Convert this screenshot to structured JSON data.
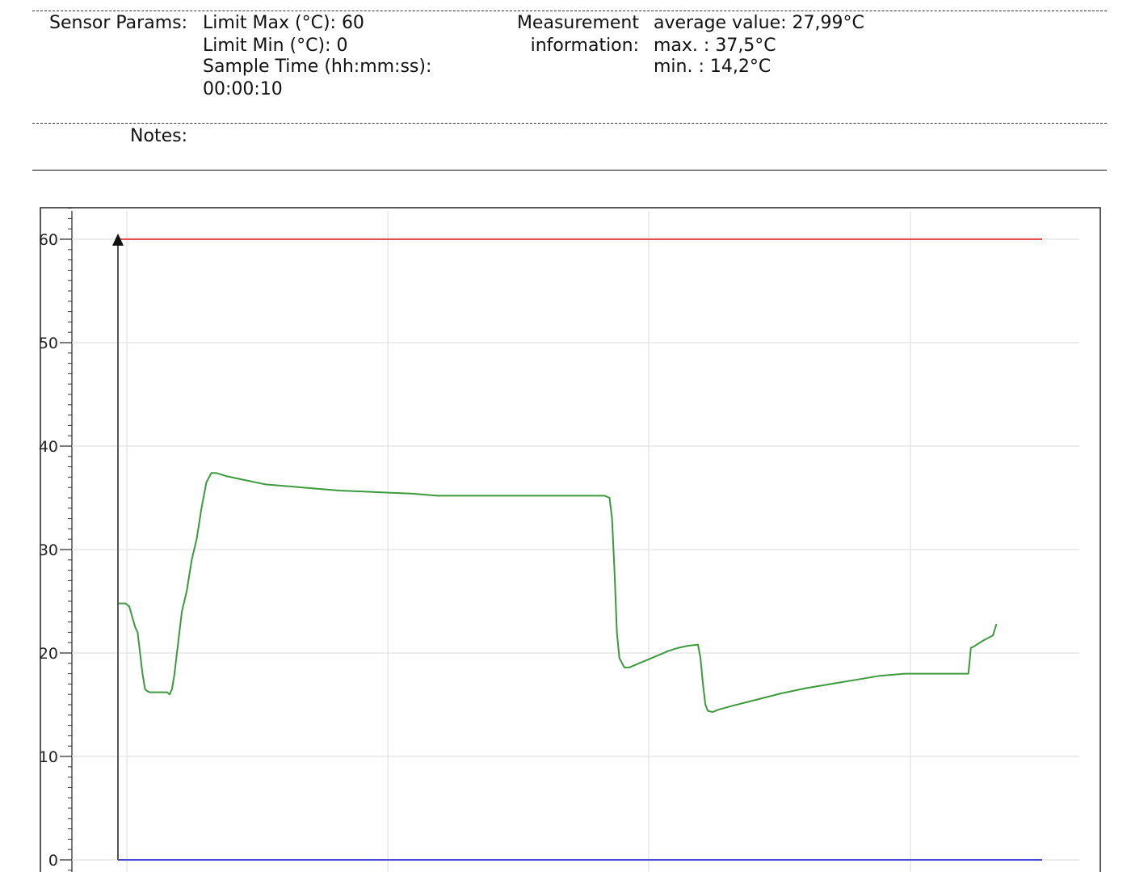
{
  "report": {
    "sensor_label": "Sensor Params:",
    "limit_max": "Limit Max (°C): 60",
    "limit_min": "Limit Min (°C): 0",
    "sample_time_label": "Sample Time (hh:mm:ss):",
    "sample_time_value": "00:00:10",
    "measurement_label_1": "Measurement",
    "measurement_label_2": "information:",
    "avg_value": "average value: 27,99°C",
    "max_value": "max. : 37,5°C",
    "min_value": "min. : 14,2°C",
    "notes_label": "Notes:"
  },
  "chart_data": {
    "type": "line",
    "y_ticks": [
      "0",
      "10",
      "20",
      "30",
      "40",
      "50",
      "60"
    ],
    "ylim": [
      -1.2,
      63
    ],
    "xlim": [
      0,
      188
    ],
    "grid": true,
    "colors": {
      "temperature": "#3c9a3c",
      "max_limit": "#e8504f",
      "min_limit": "#4a4ad8",
      "axis": "#555555",
      "grid": "#dddddd"
    },
    "max_limit": 60,
    "min_limit": 0,
    "x": [
      0,
      1.5,
      2.3,
      3.5,
      4,
      5,
      5.5,
      6,
      6.5,
      8,
      10,
      10.5,
      11,
      11.5,
      12,
      13,
      14,
      15,
      16,
      17,
      18,
      19,
      20,
      22,
      25,
      28,
      30,
      35,
      40,
      45,
      50,
      55,
      60,
      65,
      70,
      75,
      80,
      85,
      90,
      95,
      99,
      100,
      100.5,
      101,
      101.5,
      102,
      103,
      104,
      106,
      108,
      110,
      112,
      114,
      116,
      118,
      118.5,
      119,
      119.5,
      120,
      121,
      122,
      125,
      130,
      135,
      140,
      145,
      150,
      155,
      160,
      165,
      170,
      173,
      173.5,
      174,
      176,
      178,
      178.7
    ],
    "y": [
      24.8,
      24.8,
      24.5,
      22.5,
      22,
      18,
      16.5,
      16.3,
      16.2,
      16.2,
      16.2,
      16,
      16.5,
      18,
      20,
      24,
      26,
      29,
      31,
      34,
      36.5,
      37.4,
      37.4,
      37.1,
      36.8,
      36.5,
      36.3,
      36.1,
      35.9,
      35.7,
      35.6,
      35.5,
      35.4,
      35.2,
      35.2,
      35.2,
      35.2,
      35.2,
      35.2,
      35.2,
      35.2,
      35.0,
      33,
      28,
      22,
      19.5,
      18.6,
      18.6,
      19.0,
      19.4,
      19.8,
      20.2,
      20.5,
      20.7,
      20.8,
      19.5,
      17,
      15,
      14.4,
      14.3,
      14.5,
      14.9,
      15.5,
      16.1,
      16.6,
      17.0,
      17.4,
      17.8,
      18.0,
      18.0,
      18.0,
      18.0,
      20.5,
      20.6,
      21.2,
      21.7,
      22.8
    ]
  }
}
